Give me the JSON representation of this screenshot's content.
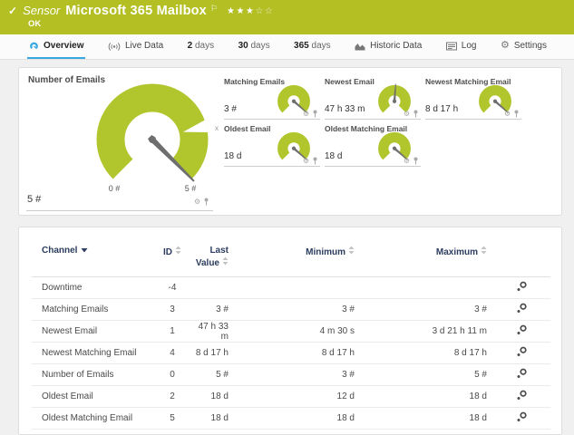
{
  "colors": {
    "header_bg": "#b3bf23",
    "gauge_green": "#b1c52d",
    "accent_blue": "#36a9e1",
    "table_header_text": "#2b3c5e",
    "needle_gray": "#6e6e6e"
  },
  "header": {
    "status_check_icon": "check-icon",
    "kind_label": "Sensor",
    "title": "Microsoft 365 Mailbox",
    "flag_icon": "flag-icon",
    "rating": {
      "filled": 3,
      "total": 5
    },
    "status_text": "OK"
  },
  "tabs": [
    {
      "id": "overview",
      "label": "Overview",
      "icon": "gauge-icon",
      "active": true
    },
    {
      "id": "live-data",
      "label": "Live Data",
      "icon": "broadcast-icon",
      "active": false
    },
    {
      "id": "2-days",
      "number": "2",
      "label": "days",
      "active": false
    },
    {
      "id": "30-days",
      "number": "30",
      "label": "days",
      "active": false
    },
    {
      "id": "365-days",
      "number": "365",
      "label": "days",
      "active": false
    },
    {
      "id": "historic-data",
      "label": "Historic Data",
      "icon": "chart-icon",
      "active": false
    },
    {
      "id": "log",
      "label": "Log",
      "icon": "log-icon",
      "active": false
    },
    {
      "id": "settings",
      "label": "Settings",
      "icon": "gear-icon",
      "active": false
    }
  ],
  "gauges": {
    "main": {
      "title": "Number of Emails",
      "value": "5 #",
      "scale_min": "0 #",
      "scale_max": "5 #",
      "needle_deg": 135,
      "marker_label": "x",
      "actions": [
        "gear-icon",
        "pin-icon"
      ]
    },
    "small": [
      {
        "title": "Matching Emails",
        "value": "3 #",
        "needle_deg": 131,
        "actions": [
          "gear-icon",
          "pin-icon"
        ]
      },
      {
        "title": "Newest Email",
        "value": "47 h 33 m",
        "needle_deg": 4,
        "actions": [
          "gear-icon",
          "pin-icon"
        ]
      },
      {
        "title": "Newest Matching Email",
        "value": "8 d 17 h",
        "needle_deg": 131,
        "actions": [
          "gear-icon",
          "pin-icon"
        ]
      },
      {
        "title": "Oldest Email",
        "value": "18 d",
        "needle_deg": 131,
        "actions": [
          "gear-icon",
          "pin-icon"
        ]
      },
      {
        "title": "Oldest Matching Email",
        "value": "18 d",
        "needle_deg": 131,
        "actions": [
          "gear-icon",
          "pin-icon"
        ]
      }
    ]
  },
  "table": {
    "columns": [
      {
        "label": "Channel",
        "sort_icon": "caret-down-icon"
      },
      {
        "label": "ID",
        "sort_icon": "sort-icon"
      },
      {
        "label": "Last Value",
        "sort_icon": "sort-icon"
      },
      {
        "label": "Minimum",
        "sort_icon": "sort-icon"
      },
      {
        "label": "Maximum",
        "sort_icon": "sort-icon"
      },
      {
        "label": "",
        "sort_icon": null
      }
    ],
    "row_action_icon": "channel-settings-icon",
    "rows": [
      {
        "channel": "Downtime",
        "id": "-4",
        "last": "",
        "min": "",
        "max": ""
      },
      {
        "channel": "Matching Emails",
        "id": "3",
        "last": "3 #",
        "min": "3 #",
        "max": "3 #"
      },
      {
        "channel": "Newest Email",
        "id": "1",
        "last": "47 h 33 m",
        "min": "4 m 30 s",
        "max": "3 d 21 h 11 m"
      },
      {
        "channel": "Newest Matching Email",
        "id": "4",
        "last": "8 d 17 h",
        "min": "8 d 17 h",
        "max": "8 d 17 h"
      },
      {
        "channel": "Number of Emails",
        "id": "0",
        "last": "5 #",
        "min": "3 #",
        "max": "5 #"
      },
      {
        "channel": "Oldest Email",
        "id": "2",
        "last": "18 d",
        "min": "12 d",
        "max": "18 d"
      },
      {
        "channel": "Oldest Matching Email",
        "id": "5",
        "last": "18 d",
        "min": "18 d",
        "max": "18 d"
      }
    ]
  }
}
